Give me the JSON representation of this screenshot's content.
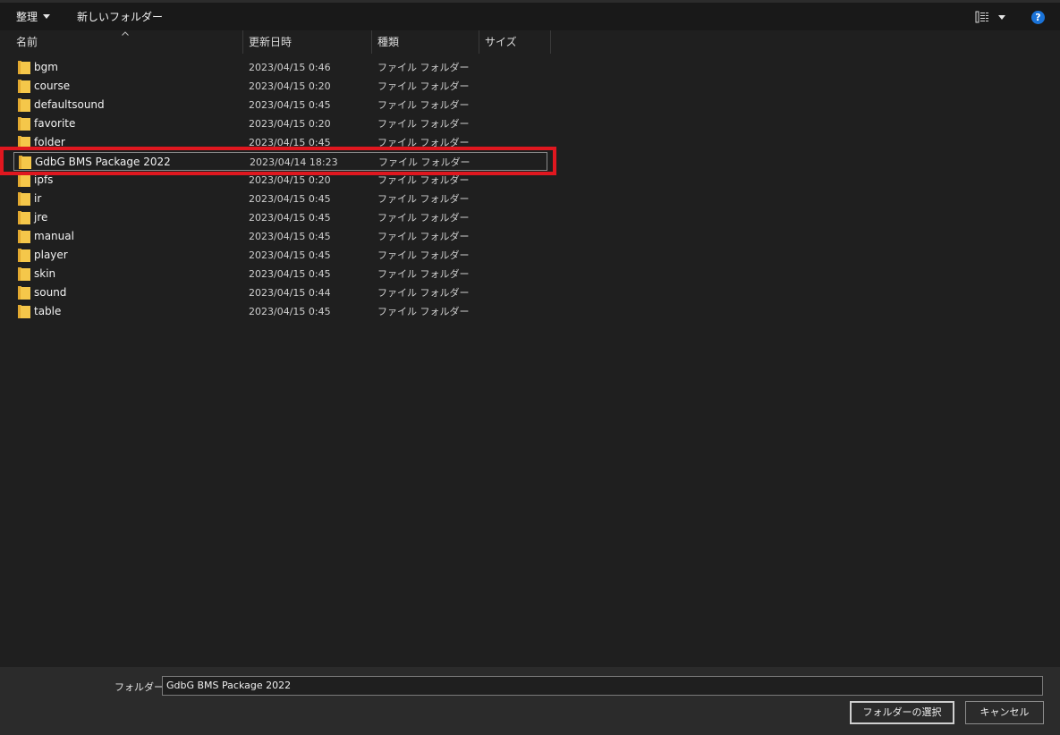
{
  "toolbar": {
    "organize_label": "整理",
    "new_folder_label": "新しいフォルダー",
    "view_icon": "view-details-icon",
    "help_label": "?"
  },
  "columns": {
    "name": "名前",
    "date": "更新日時",
    "type": "種類",
    "size": "サイズ"
  },
  "files": [
    {
      "name": "bgm",
      "date": "2023/04/15 0:46",
      "type": "ファイル フォルダー"
    },
    {
      "name": "course",
      "date": "2023/04/15 0:20",
      "type": "ファイル フォルダー"
    },
    {
      "name": "defaultsound",
      "date": "2023/04/15 0:45",
      "type": "ファイル フォルダー"
    },
    {
      "name": "favorite",
      "date": "2023/04/15 0:20",
      "type": "ファイル フォルダー"
    },
    {
      "name": "folder",
      "date": "2023/04/15 0:45",
      "type": "ファイル フォルダー"
    },
    {
      "name": "GdbG BMS Package 2022",
      "date": "2023/04/14 18:23",
      "type": "ファイル フォルダー",
      "selected": true
    },
    {
      "name": "ipfs",
      "date": "2023/04/15 0:20",
      "type": "ファイル フォルダー"
    },
    {
      "name": "ir",
      "date": "2023/04/15 0:45",
      "type": "ファイル フォルダー"
    },
    {
      "name": "jre",
      "date": "2023/04/15 0:45",
      "type": "ファイル フォルダー"
    },
    {
      "name": "manual",
      "date": "2023/04/15 0:45",
      "type": "ファイル フォルダー"
    },
    {
      "name": "player",
      "date": "2023/04/15 0:45",
      "type": "ファイル フォルダー"
    },
    {
      "name": "skin",
      "date": "2023/04/15 0:45",
      "type": "ファイル フォルダー"
    },
    {
      "name": "sound",
      "date": "2023/04/15 0:44",
      "type": "ファイル フォルダー"
    },
    {
      "name": "table",
      "date": "2023/04/15 0:45",
      "type": "ファイル フォルダー"
    }
  ],
  "footer": {
    "folder_label": "フォルダー:",
    "folder_value": "GdbG BMS Package 2022",
    "select_button": "フォルダーの選択",
    "cancel_button": "キャンセル"
  },
  "colors": {
    "background": "#1f1f1f",
    "highlight": "#e0171f",
    "folder": "#f5c74a"
  }
}
